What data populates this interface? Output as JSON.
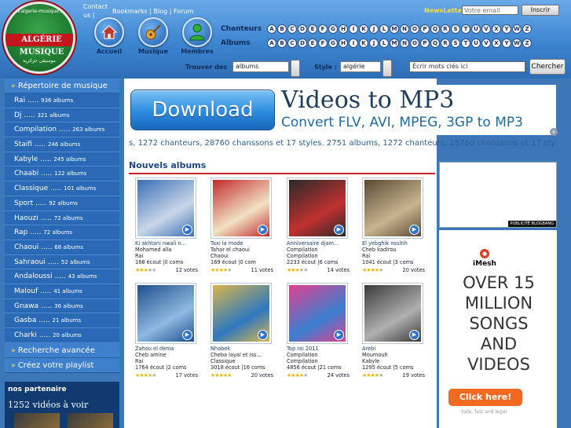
{
  "header": {
    "logo_text": "ALGÉRIE MUSIQUE",
    "logo_ring_top": "www.algerie-musique.com",
    "logo_ring_bottom": "موسيقى جزائرية",
    "contact": "Contact us",
    "separator_after_contact": "|",
    "links": [
      "Bookmarks",
      "Blog",
      "Forum"
    ],
    "nav": [
      {
        "label": "Accueil",
        "icon": "home-icon"
      },
      {
        "label": "Musique",
        "icon": "guitar-icon"
      },
      {
        "label": "Membres",
        "icon": "member-icon"
      }
    ],
    "alpha_chanteurs_label": "Chanteurs",
    "alpha_albums_label": "Albums",
    "letters": [
      "A",
      "B",
      "C",
      "D",
      "E",
      "F",
      "G",
      "H",
      "I",
      "K",
      "J",
      "L",
      "M",
      "N",
      "O",
      "P",
      "Q",
      "R",
      "S",
      "T",
      "U",
      "V",
      "X",
      "Y",
      "W",
      "Z"
    ],
    "newsletter_label": "NewsLetter",
    "newsletter_placeholder": "Votre email",
    "newsletter_button": "Inscrir"
  },
  "search": {
    "find_label": "Trouver des",
    "find_value": "albums",
    "style_label": "Style :",
    "style_value": "algérie",
    "keywords_placeholder": "Écrir mots clés ici",
    "button": "Chercher"
  },
  "sidebar": {
    "repertoire": "Répertoire de musique",
    "items": [
      {
        "name": "Rai",
        "count": "936 albums"
      },
      {
        "name": "Dj",
        "count": "321 albums"
      },
      {
        "name": "Compilation",
        "count": "263 albums"
      },
      {
        "name": "Staifi",
        "count": "246 albums"
      },
      {
        "name": "Kabyle",
        "count": "245 albums"
      },
      {
        "name": "Chaabi",
        "count": "122 albums"
      },
      {
        "name": "Classique",
        "count": "101 albums"
      },
      {
        "name": "Sport",
        "count": "92 albums"
      },
      {
        "name": "Haouzi",
        "count": "72 albums"
      },
      {
        "name": "Rap",
        "count": "72 albums"
      },
      {
        "name": "Chaoui",
        "count": "68 albums"
      },
      {
        "name": "Sahraoui",
        "count": "52 albums"
      },
      {
        "name": "Andaloussi",
        "count": "43 albums"
      },
      {
        "name": "Malouf",
        "count": "41 albums"
      },
      {
        "name": "Gnawa",
        "count": "36 albums"
      },
      {
        "name": "Gasba",
        "count": "21 albums"
      },
      {
        "name": "Charki",
        "count": "20 albums"
      }
    ],
    "advanced": "Recherche avancée",
    "playlist": "Créez votre playlist",
    "partners_title": "nos partenaire",
    "partners_videos": "1252 vidéos à voir"
  },
  "banner": {
    "button": "Download",
    "title": "Videos to MP3",
    "subtitle": "Convert FLV, AVI, MPEG, 3GP to MP3",
    "close": "x"
  },
  "ticker": "s, 1272 chanteurs, 28760 chanssons et 17 styles. 2751 albums, 1272 chanteurs, 28760 chanssons et 17 styles.",
  "section_title": "Nouvels albums",
  "albums": [
    {
      "title": "Ki akhtani nwali n...",
      "artist": "Mohamed alla",
      "style": "Rai",
      "stats": "168 écout |0 coms",
      "votes": "12 votes",
      "rating": 3,
      "colors": [
        "#3b6fb6",
        "#c9d7e8"
      ]
    },
    {
      "title": "Taxi la mode",
      "artist": "Tahar el chaoui",
      "style": "Chaoui",
      "stats": "169 écout |0 com",
      "votes": "11 votes",
      "rating": 4,
      "colors": [
        "#c22b2b",
        "#f1e2c4"
      ]
    },
    {
      "title": "Anniversaire djam...",
      "artist": "Compilation",
      "style": "Compilation",
      "stats": "2233 écout |6 coms",
      "votes": "14 votes",
      "rating": 3,
      "colors": [
        "#2a2a2a",
        "#c03030"
      ]
    },
    {
      "title": "El yebghik nssitih",
      "artist": "Cheb kadirou",
      "style": "Rai",
      "stats": "1041 écout |3 coms",
      "votes": "20 votes",
      "rating": 4,
      "colors": [
        "#5a4a35",
        "#c8b48e"
      ]
    },
    {
      "title": "Zahou el denia",
      "artist": "Cheb amine",
      "style": "Rai",
      "stats": "1764 écout |2 coms",
      "votes": "17 votes",
      "rating": 4,
      "colors": [
        "#1e4f8f",
        "#8fb9e0"
      ]
    },
    {
      "title": "Nhabek",
      "artist": "Cheba layal et iss...",
      "style": "Classique",
      "stats": "3018 écout |16 coms",
      "votes": "20 votes",
      "rating": 5,
      "colors": [
        "#d9b64a",
        "#2e78c0"
      ]
    },
    {
      "title": "Top rai 2011",
      "artist": "Compilation",
      "style": "Compilation",
      "stats": "4856 écout |21 coms",
      "votes": "24 votes",
      "rating": 4,
      "colors": [
        "#e2408f",
        "#3a7fd0"
      ]
    },
    {
      "title": "Arebi",
      "artist": "Moumouh",
      "style": "Kabyle",
      "stats": "1295 écout |5 coms",
      "votes": "19 votes",
      "rating": 4,
      "colors": [
        "#3a3a3a",
        "#b0b0b0"
      ]
    }
  ],
  "right": {
    "pub_label": "PUBLICITÉ  BLOGBANG",
    "ad_logo": "iMesh",
    "ad_text_lines": [
      "OVER 15",
      "MILLION",
      "SONGS",
      "AND",
      "VIDEOS"
    ],
    "ad_button": "Click here!",
    "ad_fine": "Safe, fast and legal"
  }
}
